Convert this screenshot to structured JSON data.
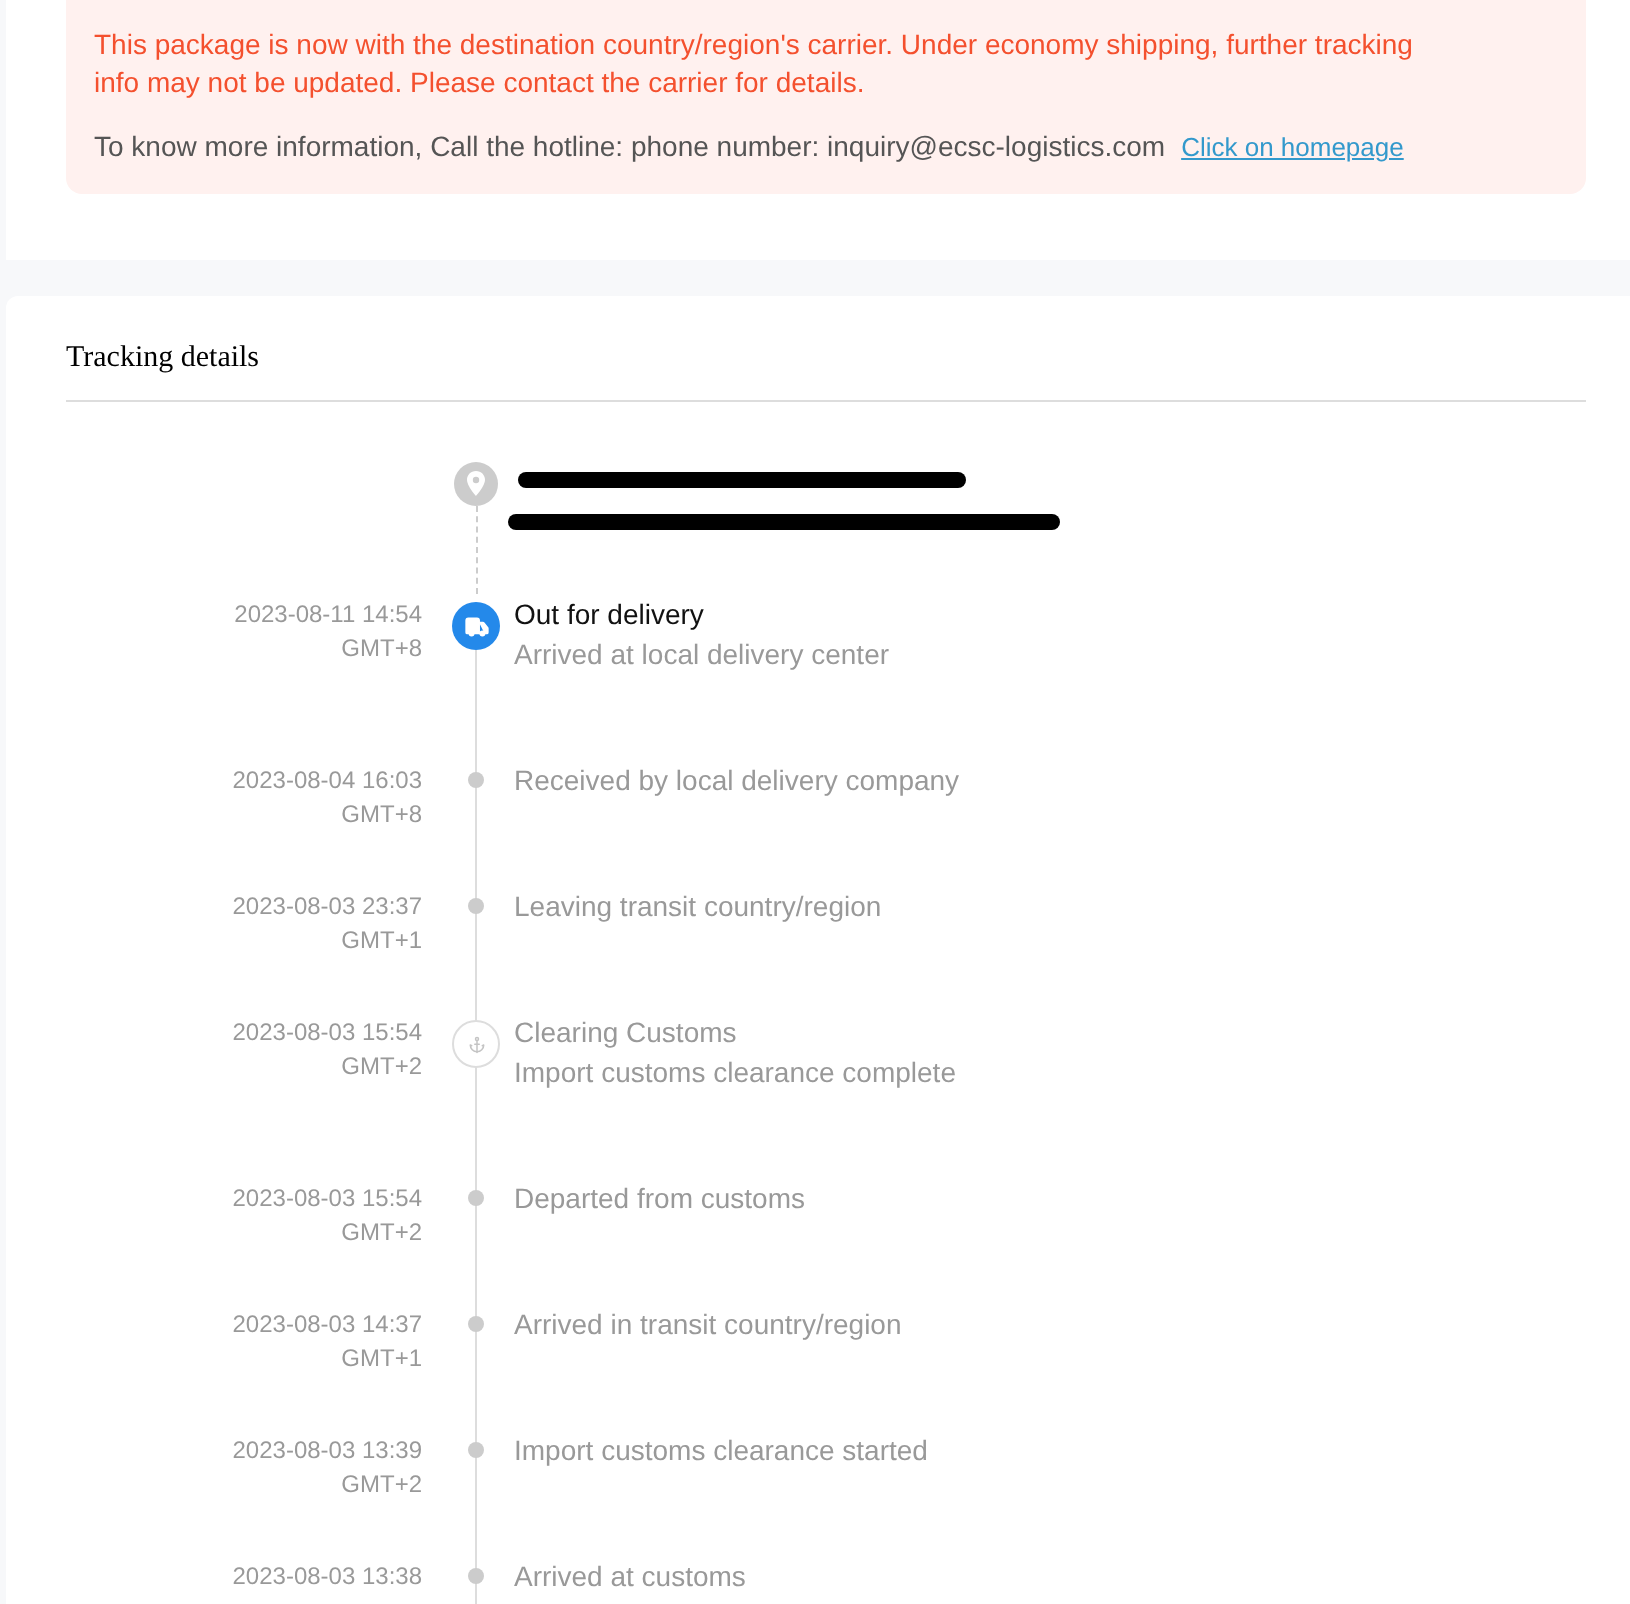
{
  "notice": {
    "message": "This package is now with the destination country/region's carrier. Under economy shipping, further tracking info may not be updated. Please contact the carrier for details.",
    "contact": "To know more information, Call the hotline: phone number: inquiry@ecsc-logistics.com",
    "link": "Click on homepage"
  },
  "tracking": {
    "title": "Tracking details",
    "destination": {
      "lines": [
        {
          "kind": "redacted"
        },
        {
          "kind": "redacted"
        }
      ]
    },
    "events": [
      {
        "kind": "current",
        "time": "2023-08-11 14:54",
        "timezone": "GMT+8",
        "title": "Out for delivery",
        "detail": "Arrived at local delivery center"
      },
      {
        "kind": "step",
        "time": "2023-08-04 16:03",
        "timezone": "GMT+8",
        "title": "Received by local delivery company"
      },
      {
        "kind": "step",
        "time": "2023-08-03 23:37",
        "timezone": "GMT+1",
        "title": "Leaving transit country/region"
      },
      {
        "kind": "customs",
        "time": "2023-08-03 15:54",
        "timezone": "GMT+2",
        "title": "Clearing Customs",
        "detail": "Import customs clearance complete"
      },
      {
        "kind": "step",
        "time": "2023-08-03 15:54",
        "timezone": "GMT+2",
        "title": "Departed from customs"
      },
      {
        "kind": "step",
        "time": "2023-08-03 14:37",
        "timezone": "GMT+1",
        "title": "Arrived in transit country/region"
      },
      {
        "kind": "step",
        "time": "2023-08-03 13:39",
        "timezone": "GMT+2",
        "title": "Import customs clearance started"
      },
      {
        "kind": "step",
        "time": "2023-08-03 13:38",
        "title": "Arrived at customs"
      }
    ]
  }
}
